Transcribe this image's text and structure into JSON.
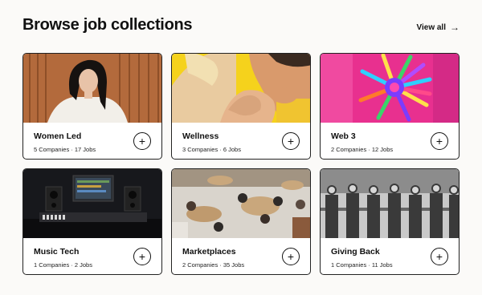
{
  "header": {
    "title": "Browse job collections",
    "view_all_label": "View all",
    "view_all_icon": "arrow-right-icon"
  },
  "collections": [
    {
      "title": "Women Led",
      "companies": "5 Companies",
      "jobs": "17 Jobs",
      "icon": "plus-icon"
    },
    {
      "title": "Wellness",
      "companies": "3 Companies",
      "jobs": "6 Jobs",
      "icon": "plus-icon"
    },
    {
      "title": "Web 3",
      "companies": "2 Companies",
      "jobs": "12 Jobs",
      "icon": "plus-icon"
    },
    {
      "title": "Music Tech",
      "companies": "1 Companies",
      "jobs": "2 Jobs",
      "icon": "plus-icon"
    },
    {
      "title": "Marketplaces",
      "companies": "2 Companies",
      "jobs": "35 Jobs",
      "icon": "plus-icon"
    },
    {
      "title": "Giving Back",
      "companies": "1 Companies",
      "jobs": "11 Jobs",
      "icon": "plus-icon"
    }
  ],
  "colors": {
    "background": "#fbfaf8",
    "border": "#222222",
    "text": "#111111",
    "wellness_yellow": "#f5d21c",
    "web3_pink": "#e8308f"
  }
}
